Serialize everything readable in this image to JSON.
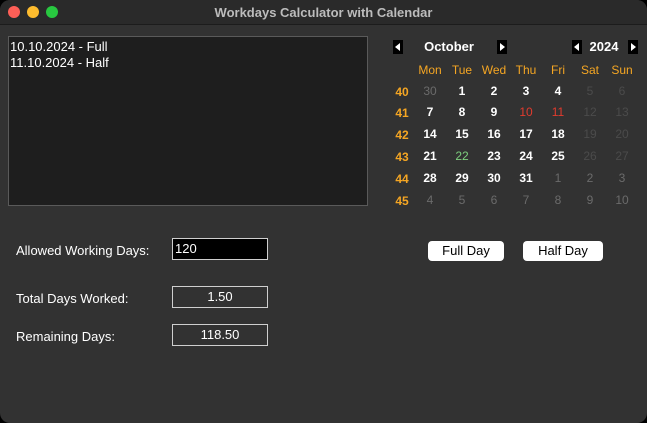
{
  "window": {
    "title": "Workdays Calculator with Calendar"
  },
  "log": {
    "entries": [
      "10.10.2024 - Full",
      "11.10.2024 - Half"
    ]
  },
  "form": {
    "allowed_label": "Allowed Working Days:",
    "allowed_value": "120",
    "total_label": "Total Days Worked:",
    "total_value": "1.50",
    "remaining_label": "Remaining Days:",
    "remaining_value": "118.50"
  },
  "buttons": {
    "full_day": "Full Day",
    "half_day": "Half Day"
  },
  "calendar": {
    "month": "October",
    "year": "2024",
    "weekdays": [
      "Mon",
      "Tue",
      "Wed",
      "Thu",
      "Fri",
      "Sat",
      "Sun"
    ],
    "weeks": [
      {
        "number": "40",
        "days": [
          {
            "d": "30",
            "state": "out"
          },
          {
            "d": "1",
            "state": "in"
          },
          {
            "d": "2",
            "state": "in"
          },
          {
            "d": "3",
            "state": "in"
          },
          {
            "d": "4",
            "state": "in"
          },
          {
            "d": "5",
            "state": "wk-out"
          },
          {
            "d": "6",
            "state": "wk-out"
          }
        ]
      },
      {
        "number": "41",
        "days": [
          {
            "d": "7",
            "state": "in"
          },
          {
            "d": "8",
            "state": "in"
          },
          {
            "d": "9",
            "state": "in"
          },
          {
            "d": "10",
            "state": "red"
          },
          {
            "d": "11",
            "state": "red"
          },
          {
            "d": "12",
            "state": "wk-out"
          },
          {
            "d": "13",
            "state": "wk-out"
          }
        ]
      },
      {
        "number": "42",
        "days": [
          {
            "d": "14",
            "state": "in"
          },
          {
            "d": "15",
            "state": "in"
          },
          {
            "d": "16",
            "state": "in"
          },
          {
            "d": "17",
            "state": "in"
          },
          {
            "d": "18",
            "state": "in"
          },
          {
            "d": "19",
            "state": "wk-out"
          },
          {
            "d": "20",
            "state": "wk-out"
          }
        ]
      },
      {
        "number": "43",
        "days": [
          {
            "d": "21",
            "state": "in"
          },
          {
            "d": "22",
            "state": "green"
          },
          {
            "d": "23",
            "state": "in"
          },
          {
            "d": "24",
            "state": "in"
          },
          {
            "d": "25",
            "state": "in"
          },
          {
            "d": "26",
            "state": "wk-out"
          },
          {
            "d": "27",
            "state": "wk-out"
          }
        ]
      },
      {
        "number": "44",
        "days": [
          {
            "d": "28",
            "state": "in"
          },
          {
            "d": "29",
            "state": "in"
          },
          {
            "d": "30",
            "state": "in"
          },
          {
            "d": "31",
            "state": "in"
          },
          {
            "d": "1",
            "state": "out"
          },
          {
            "d": "2",
            "state": "out"
          },
          {
            "d": "3",
            "state": "out"
          }
        ]
      },
      {
        "number": "45",
        "days": [
          {
            "d": "4",
            "state": "out"
          },
          {
            "d": "5",
            "state": "out"
          },
          {
            "d": "6",
            "state": "out"
          },
          {
            "d": "7",
            "state": "out"
          },
          {
            "d": "8",
            "state": "out"
          },
          {
            "d": "9",
            "state": "out"
          },
          {
            "d": "10",
            "state": "out"
          }
        ]
      }
    ]
  }
}
